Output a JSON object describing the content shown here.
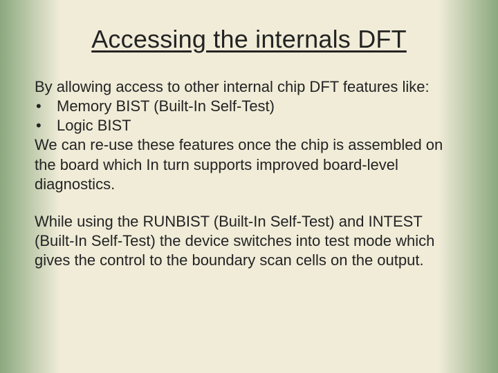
{
  "title": "Accessing the internals DFT",
  "p1_intro": "By allowing access to other internal chip DFT features like:",
  "bullets": {
    "b1": "Memory BIST (Built-In Self-Test)",
    "b2": "Logic BIST"
  },
  "p1_outro": "We can re-use these features once the chip is assembled on the board which In turn supports improved board-level diagnostics.",
  "p2": "While using the RUNBIST (Built-In Self-Test) and INTEST (Built-In Self-Test) the device switches into test mode which gives the control to the boundary scan cells on the output.",
  "bullet_char": "•"
}
